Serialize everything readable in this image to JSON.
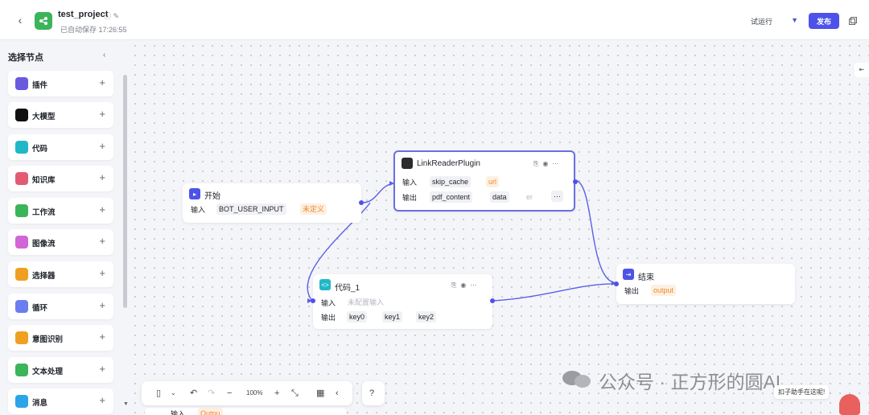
{
  "header": {
    "back_label": "‹",
    "project_title": "test_project",
    "autosave_text": "已自动保存 17:26:55",
    "trial_run_label": "试运行",
    "publish_label": "发布",
    "accent_color": "#4d53e8"
  },
  "sidebar": {
    "title": "选择节点",
    "collapse_icon": "‹",
    "items": [
      {
        "label": "插件",
        "icon": "plugin-icon",
        "color": "#6a5ae0"
      },
      {
        "label": "大模型",
        "icon": "llm-icon",
        "color": "#111111"
      },
      {
        "label": "代码",
        "icon": "code-icon",
        "color": "#20b8c7"
      },
      {
        "label": "知识库",
        "icon": "knowledge-icon",
        "color": "#e35b73"
      },
      {
        "label": "工作流",
        "icon": "workflow-icon",
        "color": "#3cb45a"
      },
      {
        "label": "图像流",
        "icon": "imageflow-icon",
        "color": "#d266d6"
      },
      {
        "label": "选择器",
        "icon": "selector-icon",
        "color": "#f0a020"
      },
      {
        "label": "循环",
        "icon": "loop-icon",
        "color": "#6b7cf0"
      },
      {
        "label": "意图识别",
        "icon": "intent-icon",
        "color": "#f0a020"
      },
      {
        "label": "文本处理",
        "icon": "text-icon",
        "color": "#3cb45a"
      },
      {
        "label": "消息",
        "icon": "message-icon",
        "color": "#2aa5e8"
      }
    ],
    "plus": "+"
  },
  "nodes": {
    "start": {
      "title": "开始",
      "input_label": "输入",
      "param": "BOT_USER_INPUT",
      "type": "未定义"
    },
    "plugin": {
      "title": "LinkReaderPlugin",
      "input_label": "输入",
      "input_param": "skip_cache",
      "input_type": "url",
      "output_label": "输出",
      "output_param1": "pdf_content",
      "output_param2": "data",
      "output_more": "er",
      "more": "···"
    },
    "code": {
      "title": "代码_1",
      "input_label": "输入",
      "input_placeholder": "未配置输入",
      "output_label": "输出",
      "out1": "key0",
      "out2": "key1",
      "out3": "key2"
    },
    "end": {
      "title": "结束",
      "output_label": "输出",
      "output_param": "output"
    },
    "bottom": {
      "input_label": "输入",
      "param": "Outpu"
    }
  },
  "toolbar": {
    "zoom": "100%",
    "mouse_caret": "⌄",
    "undo": "↶",
    "redo": "↷",
    "zoom_out": "−",
    "zoom_in": "+",
    "fit": "⤡",
    "minimap": "▦",
    "collapse": "‹",
    "help": "?"
  },
  "watermark": {
    "text": "公众号 · 正方形的圆AI"
  },
  "assistant": {
    "text": "扣子助手在这呢!"
  }
}
